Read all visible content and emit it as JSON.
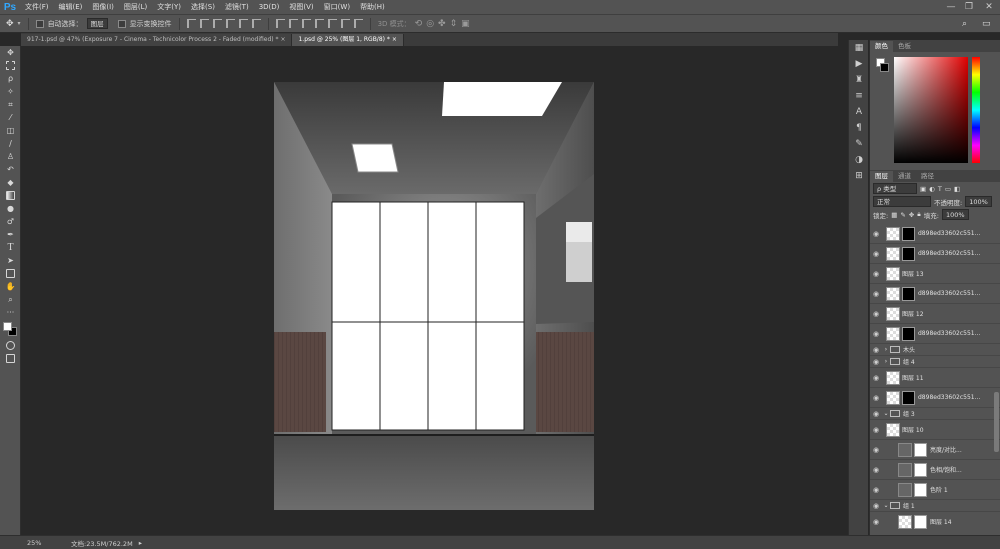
{
  "menu": {
    "logo": "Ps",
    "items": [
      "文件(F)",
      "编辑(E)",
      "图像(I)",
      "图层(L)",
      "文字(Y)",
      "选择(S)",
      "滤镜(T)",
      "3D(D)",
      "视图(V)",
      "窗口(W)",
      "帮助(H)"
    ]
  },
  "options": {
    "auto_select_label": "自动选择：",
    "auto_select_value": "图层",
    "show_transform_label": "显示变换控件",
    "mode_3d": "3D 模式："
  },
  "tabs": [
    {
      "label": "917-1.psd @ 47% (Exposure 7 - Cinema - Technicolor Process 2 - Faded (modified) *",
      "active": false
    },
    {
      "label": "1.psd @ 25% (图层 1, RGB/8) *",
      "active": true
    }
  ],
  "status": {
    "zoom": "25%",
    "doc": "文档:23.5M/762.2M"
  },
  "color_panel": {
    "tabs": [
      "颜色",
      "色板"
    ]
  },
  "layers_panel": {
    "tabs": [
      "图层",
      "通道",
      "路径"
    ],
    "filter": "ρ 类型",
    "blend_mode": "正常",
    "opacity_label": "不透明度:",
    "opacity_value": "100%",
    "lock_label": "锁定:",
    "fill_label": "填充:",
    "fill_value": "100%",
    "layers": [
      {
        "name": "d898ed33602c551...",
        "kind": "adjust_mask",
        "mask": "black"
      },
      {
        "name": "d898ed33602c551...",
        "kind": "adjust_mask",
        "mask": "black"
      },
      {
        "name": "图层 13",
        "kind": "plain"
      },
      {
        "name": "d898ed33602c551...",
        "kind": "adjust_mask",
        "mask": "black"
      },
      {
        "name": "图层 12",
        "kind": "plain"
      },
      {
        "name": "d898ed33602c551...",
        "kind": "adjust_mask",
        "mask": "black"
      },
      {
        "name": "木头",
        "kind": "group"
      },
      {
        "name": "组 4",
        "kind": "group"
      },
      {
        "name": "图层 11",
        "kind": "plain"
      },
      {
        "name": "d898ed33602c551...",
        "kind": "adjust_mask",
        "mask": "black"
      },
      {
        "name": "组 3",
        "kind": "group_open"
      },
      {
        "name": "图层 10",
        "kind": "plain"
      },
      {
        "name": "亮度/对比...",
        "kind": "adjust",
        "mask": "white"
      },
      {
        "name": "色相/饱和...",
        "kind": "adjust",
        "mask": "white"
      },
      {
        "name": "色阶 1",
        "kind": "adjust",
        "mask": "white"
      },
      {
        "name": "组 1",
        "kind": "group_open"
      },
      {
        "name": "图层 14",
        "kind": "plain_mask",
        "mask": "white"
      }
    ]
  },
  "colors": {
    "accent": "#31a8ff",
    "panel": "#535353",
    "canvas_bg": "#282828"
  }
}
